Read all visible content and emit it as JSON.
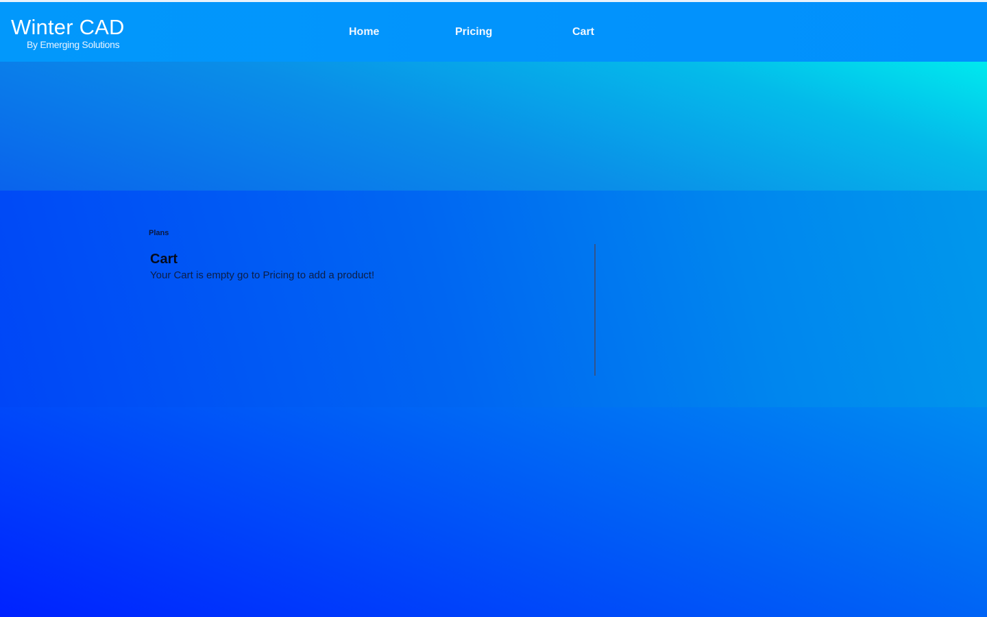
{
  "brand": {
    "title": "Winter CAD",
    "subtitle": "By Emerging Solutions"
  },
  "nav": {
    "items": [
      {
        "label": "Home"
      },
      {
        "label": "Pricing"
      },
      {
        "label": "Cart"
      }
    ]
  },
  "cart": {
    "breadcrumb": "Plans",
    "title": "Cart",
    "empty_message": "Your Cart is empty go to Pricing to add a product!"
  },
  "colors": {
    "navbar": "#0296fb",
    "background_dark": "#0022ff",
    "background_light": "#00e8ee",
    "text_dark": "#050b1c"
  }
}
